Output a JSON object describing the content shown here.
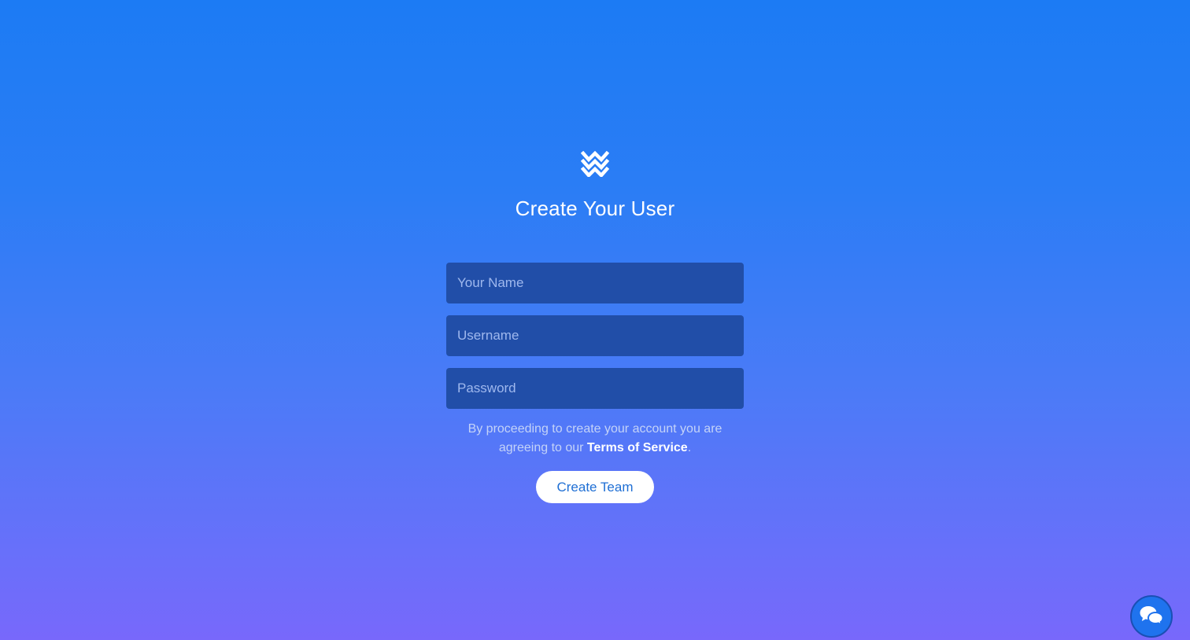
{
  "header": {
    "logo_icon": "wave-logo-icon",
    "title": "Create Your User"
  },
  "form": {
    "name_placeholder": "Your Name",
    "username_placeholder": "Username",
    "password_placeholder": "Password",
    "terms_prefix": "By proceeding to create your account you are agreeing to our ",
    "terms_link": "Terms of Service",
    "terms_suffix": ".",
    "submit_label": "Create Team"
  },
  "chat_widget": {
    "icon": "chat-bubbles-icon"
  },
  "colors": {
    "background_top": "#1c7bf4",
    "background_bottom": "#7868fb",
    "field_bg": "#214ea8",
    "button_text": "#1f6fd4"
  }
}
